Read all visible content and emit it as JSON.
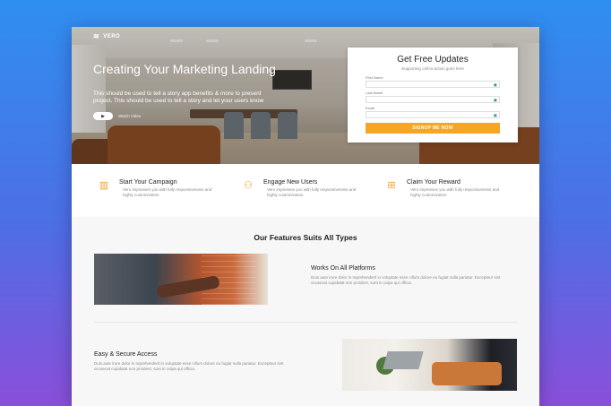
{
  "brand": {
    "logo_mark": "≋",
    "name": "VERO"
  },
  "hero": {
    "title": "Creating Your Marketing Landing",
    "subtitle": "This should be used to tell a story app benefits & more to present project. This should be used to tell a story and let your users know",
    "play_icon": "play-icon",
    "play_label": "Watch Video"
  },
  "form": {
    "title": "Get Free Updates",
    "tagline": "Supporting call-to-action goes here",
    "fields": [
      {
        "label": "First Name",
        "icon": "user-icon"
      },
      {
        "label": "Last Name",
        "icon": "user-icon"
      },
      {
        "label": "Email",
        "icon": "email-icon"
      }
    ],
    "submit_label": "SIGNUP ME NOW"
  },
  "features": [
    {
      "title": "Start Your Campaign",
      "text": "Vero impresses you with fully responsiveness and highly customization",
      "icon": "chart-icon"
    },
    {
      "title": "Engage New Users",
      "text": "Vero impresses you with fully responsiveness and highly customization",
      "icon": "users-icon"
    },
    {
      "title": "Claim Your Reward",
      "text": "Vero impresses you with fully responsiveness and highly customization",
      "icon": "gift-icon"
    }
  ],
  "section": {
    "heading": "Our Features Suits All Types",
    "blocks": [
      {
        "title": "Works On All Platforms",
        "text": "Duis aute irure dolor in reprehenderit in voluptate esse cillum dolore eu fugiat nulla pariatur. Excepteur sint occaecat cupidatat non proident, sunt in culpa qui officia."
      },
      {
        "title": "Easy & Secure Access",
        "text": "Duis aute irure dolor in reprehenderit in voluptate esse cillum dolore eu fugiat nulla pariatur. Excepteur sint occaecat cupidatat non proident, sunt in culpa qui officia."
      }
    ]
  },
  "colors": {
    "accent": "#f6a623",
    "background_top": "#2f8ff0",
    "background_bottom": "#8a4fd9"
  }
}
